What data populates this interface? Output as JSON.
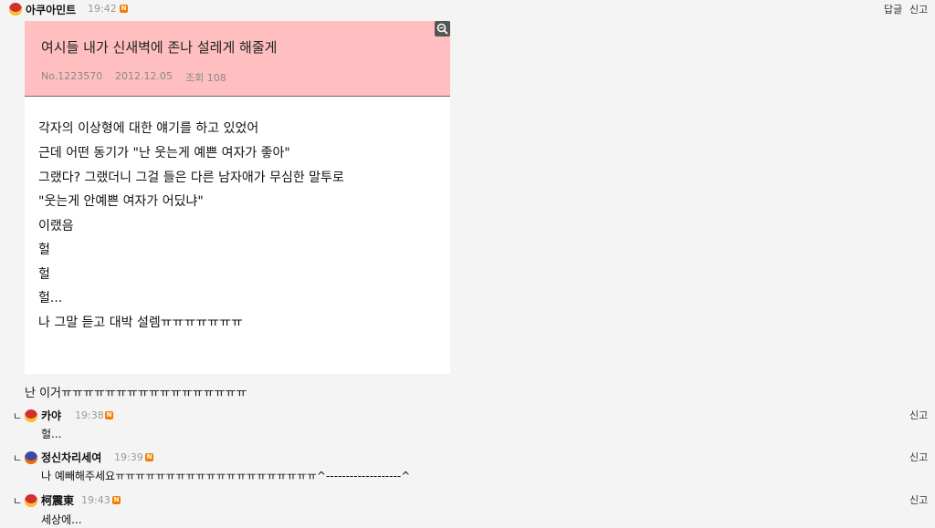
{
  "post": {
    "author": "아쿠아민트",
    "time": "19:42",
    "badge": "N",
    "actions": {
      "reply": "답글",
      "report": "신고"
    }
  },
  "card": {
    "title": "여시들 내가 신새벽에 존나 설레게 해줄게",
    "no": "No.1223570",
    "date": "2012.12.05",
    "views": "조회 108",
    "lines": [
      "각자의 이상형에 대한 얘기를 하고 있었어",
      "근데 어떤 동기가 \"난 웃는게 예쁜 여자가 좋아\"",
      "그랬다? 그랬더니 그걸 들은 다른 남자애가 무심한 말투로",
      "\"웃는게 안예쁜 여자가 어딨냐\"",
      "이랬음",
      "헐",
      "헐",
      "헐...",
      "나 그말 듣고 대박 설렘ㅠㅠㅠㅠㅠㅠㅠ"
    ]
  },
  "post_comment": "난 이거ㅠㅠㅠㅠㅠㅠㅠㅠㅠㅠㅠㅠㅠㅠㅠㅠㅠ",
  "replies": [
    {
      "marker": "ㄴ",
      "author": "카야",
      "time": "19:38",
      "badge": "N",
      "text": "헐...",
      "report": "신고"
    },
    {
      "marker": "ㄴ",
      "author": "정신차리세여",
      "time": "19:39",
      "badge": "N",
      "text": "나 예빼해주세요ㅠㅠㅠㅠㅠㅠㅠㅠㅠㅠㅠㅠㅠㅠㅠㅠㅠㅠㅠㅠ^-------------------^",
      "report": "신고"
    },
    {
      "marker": "ㄴ",
      "author": "柯震東",
      "time": "19:43",
      "badge": "N",
      "text": "세상에...",
      "report": "신고"
    }
  ]
}
